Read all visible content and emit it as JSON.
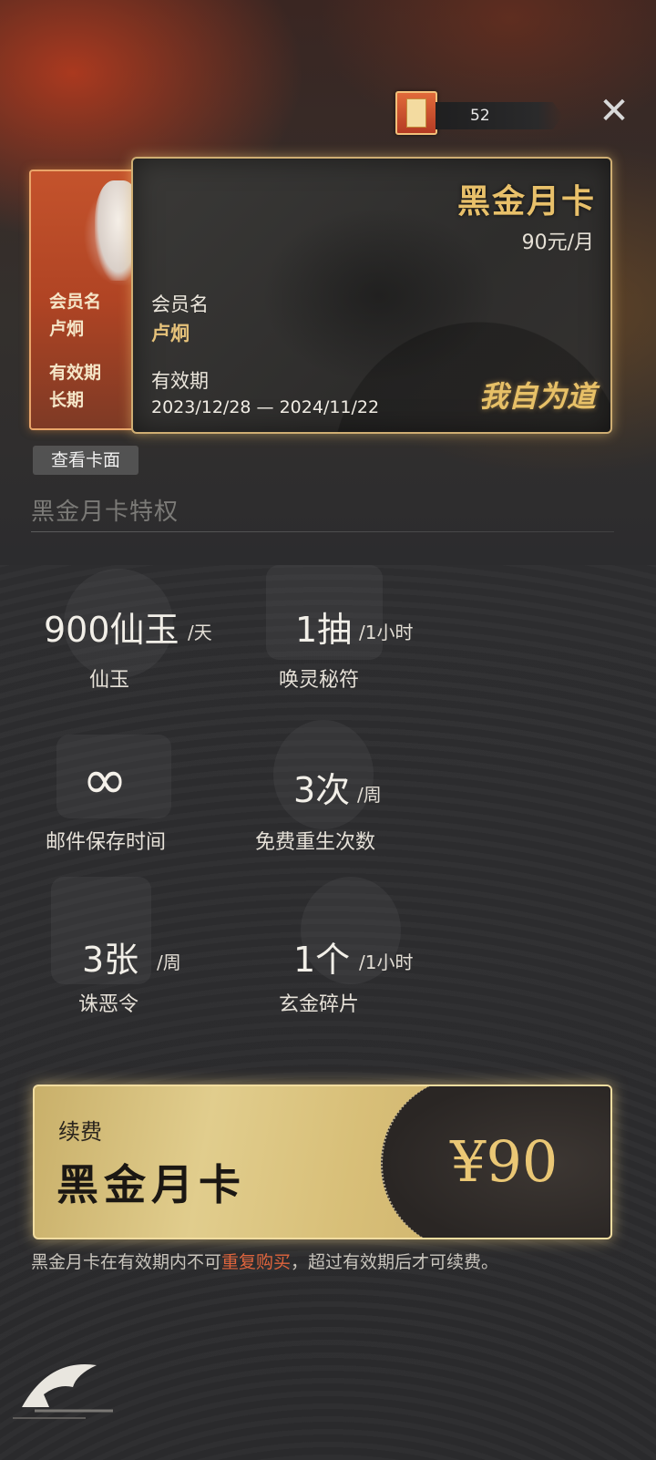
{
  "currency": {
    "amount": "52",
    "icon": "scroll-ticket-icon"
  },
  "close": {
    "icon": "close-icon",
    "glyph": "✕"
  },
  "back_card": {
    "member_label": "会员名",
    "member_value": "卢炯",
    "validity_label": "有效期",
    "validity_value": "长期"
  },
  "front_card": {
    "title": "黑金月卡",
    "price": "90元/月",
    "member_label": "会员名",
    "member_value": "卢炯",
    "validity_label": "有效期",
    "dates": "2023/12/28 — 2024/11/22",
    "slogan": "我自为道"
  },
  "view_card_label": "查看卡面",
  "section_title": "黑金月卡特权",
  "perks": [
    {
      "amount": "900仙玉",
      "unit": "/天",
      "name": "仙玉"
    },
    {
      "amount": "1抽",
      "unit": "/1小时",
      "name": "唤灵秘符"
    },
    {
      "amount": "∞",
      "unit": "",
      "name": "邮件保存时间"
    },
    {
      "amount": "3次",
      "unit": "/周",
      "name": "免费重生次数"
    },
    {
      "amount": "3张",
      "unit": "/周",
      "name": "诛恶令"
    },
    {
      "amount": "1个",
      "unit": "/1小时",
      "name": "玄金碎片"
    }
  ],
  "renew": {
    "label": "续费",
    "name": "黑金月卡",
    "price": "¥90"
  },
  "notice": {
    "before": "黑金月卡在有效期内不可",
    "highlight": "重复购买",
    "after": "，超过有效期后才可续费。"
  },
  "colors": {
    "gold": "#e8c06a",
    "highlight": "#e0653d",
    "background": "#2b2b2d"
  }
}
